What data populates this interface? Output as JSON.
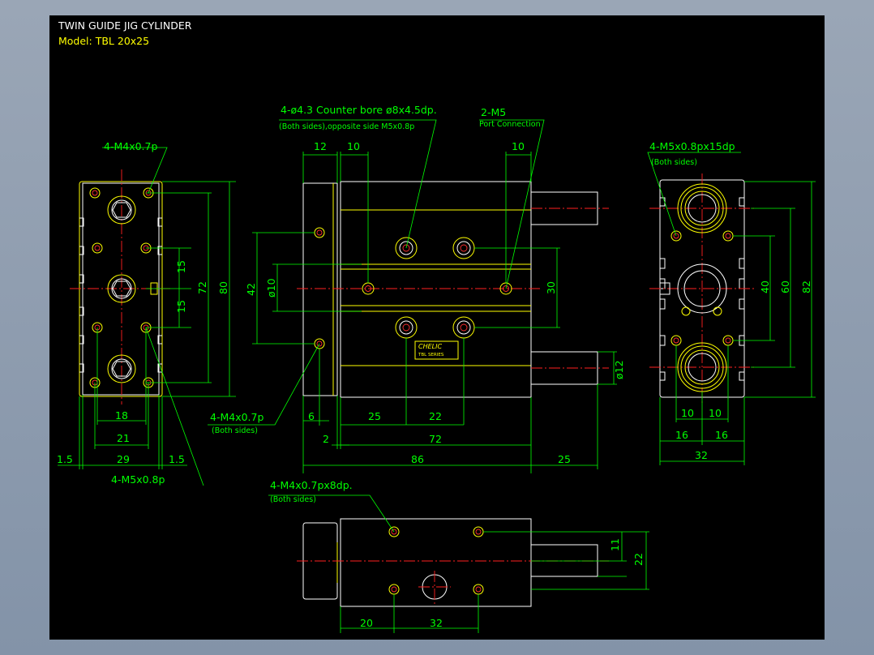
{
  "title_block": {
    "title": "TWIN GUIDE JIG CYLINDER",
    "model": "Model:  TBL 20x25"
  },
  "callouts": {
    "left_top": "4-M4x0.7p",
    "left_mid": "4-M4x0.7p",
    "left_mid_sub": "(Both sides)",
    "left_bottom": "4-M5x0.8p",
    "front_counterbore": "4-ø4.3  Counter bore  ø8x4.5dp.",
    "front_counterbore_sub": "(Both sides),opposite side  M5x0.8p",
    "front_port": "2-M5",
    "front_port_sub": "Port Connection",
    "right_thread": "4-M5x0.8px15dp",
    "right_thread_sub": "(Both sides)",
    "bottom_thread": "4-M4x0.7px8dp.",
    "bottom_thread_sub": "(Both sides)"
  },
  "dims": {
    "left_view": {
      "h18": "18",
      "h21": "21",
      "h29": "29",
      "h1_5a": "1.5",
      "h1_5b": "1.5",
      "v15a": "15",
      "v15b": "15",
      "v72": "72",
      "v80": "80"
    },
    "front_view": {
      "h12": "12",
      "h10a": "10",
      "h10b": "10",
      "v42": "42",
      "d10": "ø10",
      "v30": "30",
      "d12": "ø12",
      "h6": "6",
      "h25a": "25",
      "h22": "22",
      "h2": "2",
      "h72": "72",
      "h86": "86",
      "h25b": "25"
    },
    "right_view": {
      "v40": "40",
      "v60": "60",
      "v82": "82",
      "h10a": "10",
      "h10b": "10",
      "h16a": "16",
      "h16b": "16",
      "h32": "32"
    },
    "bottom_view": {
      "v11": "11",
      "v22": "22",
      "h20": "20",
      "h32": "32"
    }
  },
  "logo": {
    "brand": "CHELIC",
    "line": "TBL SERIES"
  },
  "colors": {
    "background": "#000000",
    "frame": "#ffffff",
    "body_edges": "#ffff00",
    "dimension": "#00ff00",
    "centerline": "#ff2020"
  }
}
